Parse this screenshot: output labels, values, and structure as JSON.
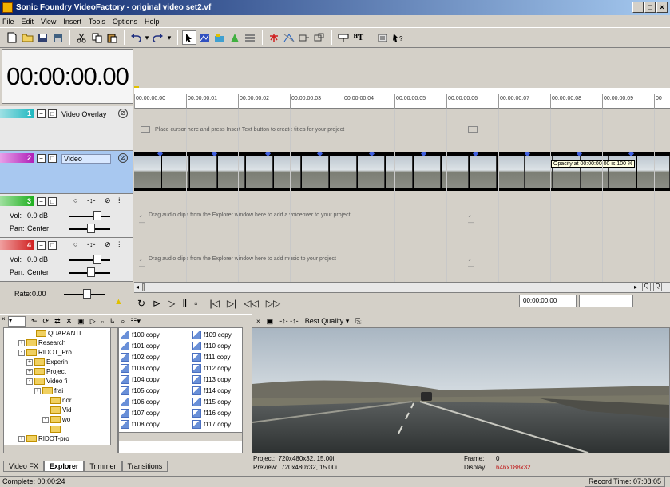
{
  "window": {
    "title": "Sonic Foundry VideoFactory - original video set2.vf"
  },
  "menu": [
    "File",
    "Edit",
    "View",
    "Insert",
    "Tools",
    "Options",
    "Help"
  ],
  "timecode": "00:00:00.00",
  "ruler": [
    "00:00:00.00",
    "00:00:00.01",
    "00:00:00.02",
    "00:00:00.03",
    "00:00:00.04",
    "00:00:00.05",
    "00:00:00.06",
    "00:00:00.07",
    "00:00:00.08",
    "00:00:00.09",
    "00"
  ],
  "tracks": {
    "t1": {
      "num": "1",
      "name": "Video Overlay",
      "hint": "Place cursor here and press Insert Text button to create titles for your project",
      "color": "#20b8c0"
    },
    "t2": {
      "num": "2",
      "name": "Video",
      "tooltip": "Opacity at 00:00:00.00 is 100 %",
      "color": "#b020b8"
    },
    "t3": {
      "num": "3",
      "vol_label": "Vol:",
      "vol": "0.0 dB",
      "pan_label": "Pan:",
      "pan": "Center",
      "hint": "Drag audio clips from the Explorer window here to add a voiceover to your project",
      "color": "#20b020"
    },
    "t4": {
      "num": "4",
      "vol_label": "Vol:",
      "vol": "0.0 dB",
      "pan_label": "Pan:",
      "pan": "Center",
      "hint": "Drag audio clips from the Explorer window here to add music to your project",
      "color": "#d02020"
    }
  },
  "rate": {
    "label": "Rate:",
    "value": "0.00"
  },
  "transport_time": "00:00:00.00",
  "tree": [
    {
      "label": "QUARANTI",
      "indent": 2,
      "pm": ""
    },
    {
      "label": "Research",
      "indent": 1,
      "pm": "+"
    },
    {
      "label": "RIDOT_Pro",
      "indent": 1,
      "pm": "-"
    },
    {
      "label": "Experin",
      "indent": 2,
      "pm": "+"
    },
    {
      "label": "Project",
      "indent": 2,
      "pm": "+"
    },
    {
      "label": "Video fi",
      "indent": 2,
      "pm": "-"
    },
    {
      "label": "frai",
      "indent": 3,
      "pm": "+"
    },
    {
      "label": "nor",
      "indent": 4,
      "pm": ""
    },
    {
      "label": "Vid",
      "indent": 4,
      "pm": ""
    },
    {
      "label": "wo",
      "indent": 3,
      "pm": "-"
    },
    {
      "label": "",
      "indent": 4,
      "pm": ""
    },
    {
      "label": "RIDOT-pro",
      "indent": 1,
      "pm": "+"
    }
  ],
  "files_col1": [
    "f100 copy",
    "f101 copy",
    "f102 copy",
    "f103 copy",
    "f104 copy",
    "f105 copy",
    "f106 copy",
    "f107 copy",
    "f108 copy"
  ],
  "files_col2": [
    "f109 copy",
    "f110 copy",
    "f111 copy",
    "f112 copy",
    "f113 copy",
    "f114 copy",
    "f115 copy",
    "f116 copy",
    "f117 copy"
  ],
  "tabs": [
    "Video FX",
    "Explorer",
    "Trimmer",
    "Transitions"
  ],
  "active_tab": "Explorer",
  "preview": {
    "quality": "Best Quality",
    "project": "Project:  720x480x32, 15.00i",
    "preview": "Preview:  720x480x32, 15.00i",
    "frame_label": "Frame:",
    "frame": "0",
    "display_label": "Display:",
    "display": "646x188x32",
    "display_color": "#c02020"
  },
  "status": {
    "left": "Complete: 00:00:24",
    "right": "Record Time: 07:08:05"
  }
}
